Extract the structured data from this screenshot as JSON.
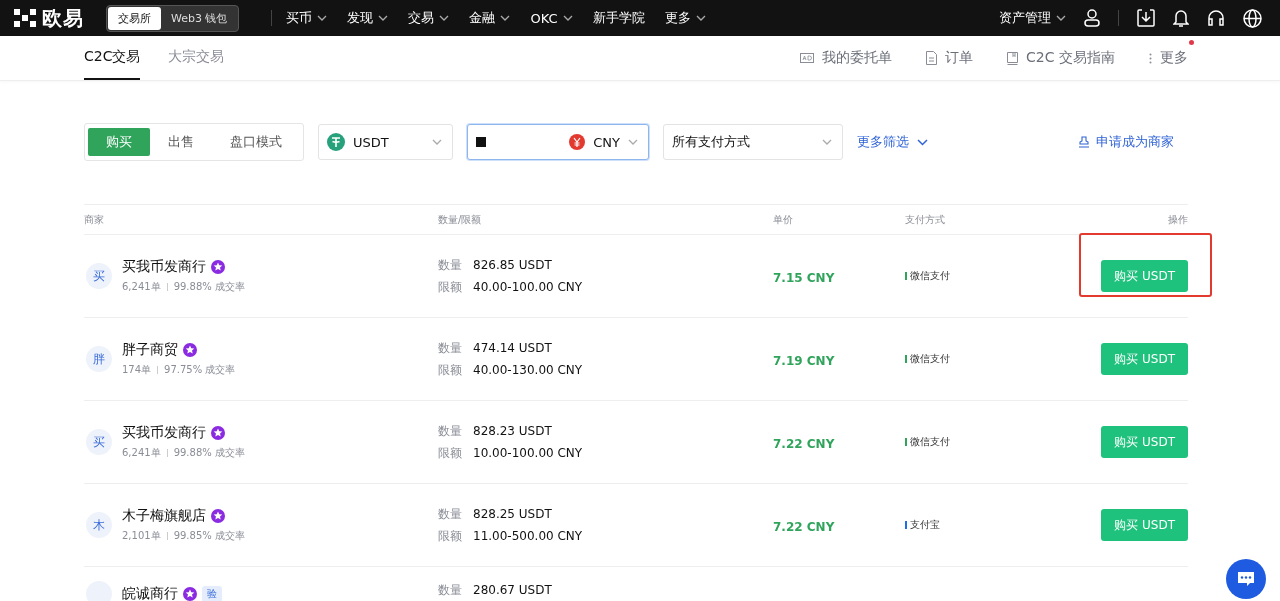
{
  "top_nav": {
    "logo_text": "欧易",
    "mode_toggle": [
      {
        "label": "交易所",
        "selected": true
      },
      {
        "label": "Web3 钱包",
        "selected": false
      }
    ],
    "menu": [
      {
        "label": "买币",
        "dropdown": true
      },
      {
        "label": "发现",
        "dropdown": true
      },
      {
        "label": "交易",
        "dropdown": true
      },
      {
        "label": "金融",
        "dropdown": true
      },
      {
        "label": "OKC",
        "dropdown": true
      },
      {
        "label": "新手学院",
        "dropdown": false
      },
      {
        "label": "更多",
        "dropdown": true
      }
    ],
    "asset_menu": "资产管理"
  },
  "sub_nav": {
    "tabs": [
      {
        "label": "C2C交易",
        "selected": true
      },
      {
        "label": "大宗交易",
        "selected": false
      }
    ],
    "links": [
      {
        "kind": "ad",
        "label": "我的委托单",
        "notify": false
      },
      {
        "kind": "doc",
        "label": "订单",
        "notify": false
      },
      {
        "kind": "book",
        "label": "C2C 交易指南",
        "notify": false
      },
      {
        "kind": "dots",
        "label": "更多",
        "notify": true
      }
    ]
  },
  "filters": {
    "trade_side": [
      {
        "label": "购买",
        "selected": true
      },
      {
        "label": "出售",
        "selected": false
      },
      {
        "label": "盘口模式",
        "selected": false
      }
    ],
    "crypto": "USDT",
    "currency": "CNY",
    "payment": "所有支付方式",
    "more_filters": "更多筛选",
    "apply_merchant": "申请成为商家"
  },
  "table": {
    "columns": [
      "商家",
      "数量/限额",
      "单价",
      "支付方式",
      "操作"
    ],
    "rows": [
      {
        "avatar": "买",
        "name": "买我币发商行",
        "orders": "6,241单",
        "rate": "99.88% 成交率",
        "qty_label": "数量",
        "qty": "826.85 USDT",
        "limit_label": "限额",
        "limit": "40.00-100.00 CNY",
        "price": "7.15 CNY",
        "payment": "微信支付",
        "color": "#31a45c",
        "action": "购买 USDT",
        "highlighted": true
      },
      {
        "avatar": "胖",
        "name": "胖子商贸",
        "orders": "174单",
        "rate": "97.75% 成交率",
        "qty_label": "数量",
        "qty": "474.14 USDT",
        "limit_label": "限额",
        "limit": "40.00-130.00 CNY",
        "price": "7.19 CNY",
        "payment": "微信支付",
        "color": "#31a45c",
        "action": "购买 USDT",
        "highlighted": false
      },
      {
        "avatar": "买",
        "name": "买我币发商行",
        "orders": "6,241单",
        "rate": "99.88% 成交率",
        "qty_label": "数量",
        "qty": "828.23 USDT",
        "limit_label": "限额",
        "limit": "10.00-100.00 CNY",
        "price": "7.22 CNY",
        "payment": "微信支付",
        "color": "#31a45c",
        "action": "购买 USDT",
        "highlighted": false
      },
      {
        "avatar": "木",
        "name": "木子梅旗舰店",
        "orders": "2,101单",
        "rate": "99.85% 成交率",
        "qty_label": "数量",
        "qty": "828.25 USDT",
        "limit_label": "限额",
        "limit": "11.00-500.00 CNY",
        "price": "7.22 CNY",
        "payment": "支付宝",
        "color": "#1f6fe0",
        "action": "购买 USDT",
        "highlighted": false
      },
      {
        "name": "皖诚商行",
        "badge": "验",
        "qty_label": "数量",
        "qty": "280.67 USDT",
        "highlighted": false
      }
    ]
  }
}
